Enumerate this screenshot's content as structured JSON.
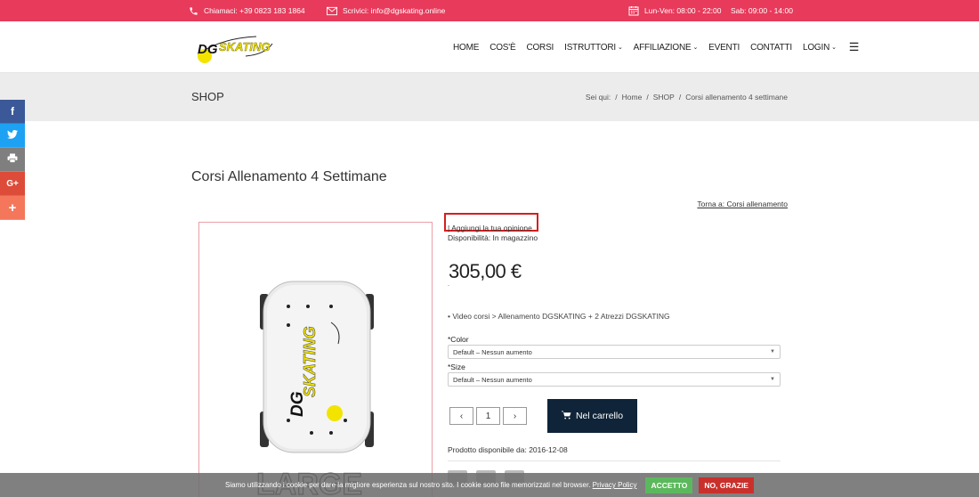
{
  "topbar": {
    "phone": "Chiamaci: +39 0823 183 1864",
    "email": "Scrivici: info@dgskating.online",
    "hours_weekday": "Lun-Ven: 08:00 - 22:00",
    "hours_saturday": "Sab: 09:00 - 14:00",
    "color": "#e83a5b"
  },
  "nav": {
    "items": [
      {
        "label": "HOME"
      },
      {
        "label": "COS'È"
      },
      {
        "label": "CORSI"
      },
      {
        "label": "ISTRUTTORI"
      },
      {
        "label": "AFFILIAZIONE"
      },
      {
        "label": "EVENTI"
      },
      {
        "label": "CONTATTI"
      },
      {
        "label": "LOGIN"
      }
    ]
  },
  "title_band": {
    "heading": "SHOP",
    "breadcrumb_prefix": "Sei qui:",
    "breadcrumb_sep": "/",
    "crumbs": [
      "Home",
      "SHOP",
      "Corsi allenamento 4 settimane"
    ]
  },
  "product": {
    "title": "Corsi Allenamento 4 Settimane",
    "back_link": "Torna a: Corsi allenamento",
    "review_link": "| Aggiungi la tua opinione",
    "availability": "Disponibilità: In magazzino",
    "price": "305,00 €",
    "tiny_link": "-",
    "bullet": "Video corsi > Allenamento DGSKATING + 2 Atrezzi DGSKATING",
    "color_label": "*Color",
    "color_value": "Default – Nessun aumento",
    "size_label": "*Size",
    "size_value": "Default – Nessun aumento",
    "qty_minus": "‹",
    "qty_value": "1",
    "qty_plus": "›",
    "cart_label": "Nel carrello",
    "available_from": "Prodotto disponibile da: 2016-12-08"
  },
  "cookie": {
    "message": "Siamo utilizzando i cookie per dare la migliore esperienza sul nostro sito. I cookie sono file memorizzati nel browser.",
    "privacy_link": "Privacy Policy",
    "accept": "ACCETTO",
    "decline": "NO, GRAZIE"
  },
  "social": [
    "f",
    "t",
    "print",
    "G+",
    "+"
  ],
  "logo_text": "DGSKATING",
  "image_text": "LARGE"
}
